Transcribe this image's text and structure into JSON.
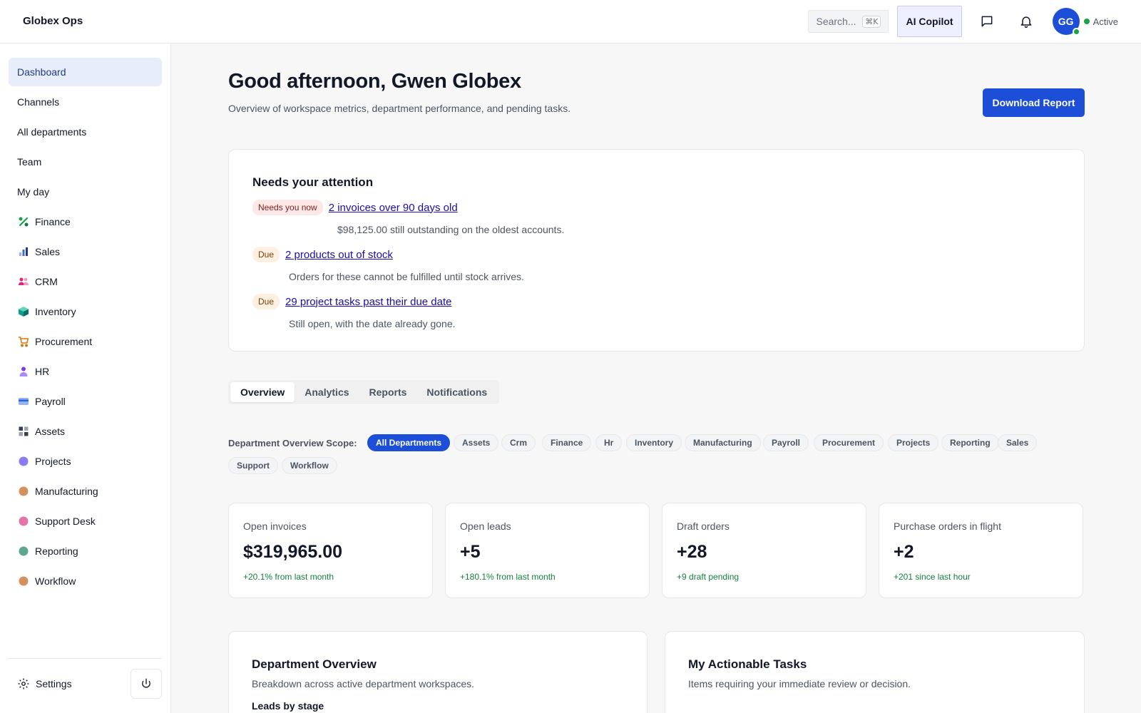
{
  "app": {
    "brand": "Globex Ops"
  },
  "topbar": {
    "search_placeholder": "Search...",
    "search_shortcut": "⌘K",
    "copilot_label": "AI Copilot",
    "chat_icon": "chat-icon",
    "bell_icon": "bell-icon",
    "avatar_initials": "GG",
    "status": "Active"
  },
  "sidebar": {
    "items": [
      {
        "label": "Dashboard",
        "active": true
      },
      {
        "label": "Channels"
      },
      {
        "label": "All departments"
      },
      {
        "label": "Team"
      },
      {
        "label": "My day"
      },
      {
        "label": "Finance",
        "icon": "percent-icon",
        "color": "#16a34a"
      },
      {
        "label": "Sales",
        "icon": "bar-chart-icon",
        "color": "#3b6fd8"
      },
      {
        "label": "CRM",
        "icon": "users-icon",
        "color": "#db2777"
      },
      {
        "label": "Inventory",
        "icon": "box-icon",
        "color": "#0f9d8a"
      },
      {
        "label": "Procurement",
        "icon": "cart-icon",
        "color": "#d97706"
      },
      {
        "label": "HR",
        "icon": "person-icon",
        "color": "#7c3aed"
      },
      {
        "label": "Payroll",
        "icon": "card-icon",
        "color": "#2563eb"
      },
      {
        "label": "Assets",
        "icon": "grid-icon",
        "color": "#374151"
      },
      {
        "label": "Projects",
        "icon": "dot-icon",
        "color": "#8b7cf6"
      },
      {
        "label": "Manufacturing",
        "icon": "dot-icon",
        "color": "#d4915e"
      },
      {
        "label": "Support Desk",
        "icon": "dot-icon",
        "color": "#e573a8"
      },
      {
        "label": "Reporting",
        "icon": "dot-icon",
        "color": "#5fa88f"
      },
      {
        "label": "Workflow",
        "icon": "dot-icon",
        "color": "#d4915e"
      }
    ],
    "settings_label": "Settings"
  },
  "header": {
    "greeting": "Good afternoon, Gwen Globex",
    "subtitle": "Overview of workspace metrics, department performance, and pending tasks.",
    "download_label": "Download Report"
  },
  "attention": {
    "title": "Needs your attention",
    "items": [
      {
        "badge": "Needs you now",
        "link": "2 invoices over 90 days old",
        "desc": "$98,125.00 still outstanding on the oldest accounts."
      },
      {
        "badge": "Due",
        "link": "2 products out of stock",
        "desc": "Orders for these cannot be fulfilled until stock arrives."
      },
      {
        "badge": "Due",
        "link": "29 project tasks past their due date",
        "desc": "Still open, with the date already gone."
      }
    ]
  },
  "tabs": [
    "Overview",
    "Analytics",
    "Reports",
    "Notifications"
  ],
  "scope": {
    "label": "Department Overview Scope:",
    "chips": [
      "All Departments",
      "Assets",
      "Crm",
      "Finance",
      "Hr",
      "Inventory",
      "Manufacturing",
      "Payroll",
      "Procurement",
      "Projects",
      "Reporting",
      "Sales",
      "Support",
      "Workflow"
    ]
  },
  "stats": [
    {
      "label": "Open invoices",
      "value": "$319,965.00",
      "delta": "+20.1% from last month"
    },
    {
      "label": "Open leads",
      "value": "+5",
      "delta": "+180.1% from last month"
    },
    {
      "label": "Draft orders",
      "value": "+28",
      "delta": "+9 draft pending"
    },
    {
      "label": "Purchase orders in flight",
      "value": "+2",
      "delta": "+201 since last hour"
    }
  ],
  "panels": {
    "department": {
      "title": "Department Overview",
      "subtitle": "Breakdown across active department workspaces.",
      "section": "Leads by stage"
    },
    "tasks": {
      "title": "My Actionable Tasks",
      "subtitle": "Items requiring your immediate review or decision."
    }
  },
  "colors": {
    "accent": "#1d4ed8",
    "positive": "#15803d",
    "active_nav_bg": "#e8eef9"
  }
}
